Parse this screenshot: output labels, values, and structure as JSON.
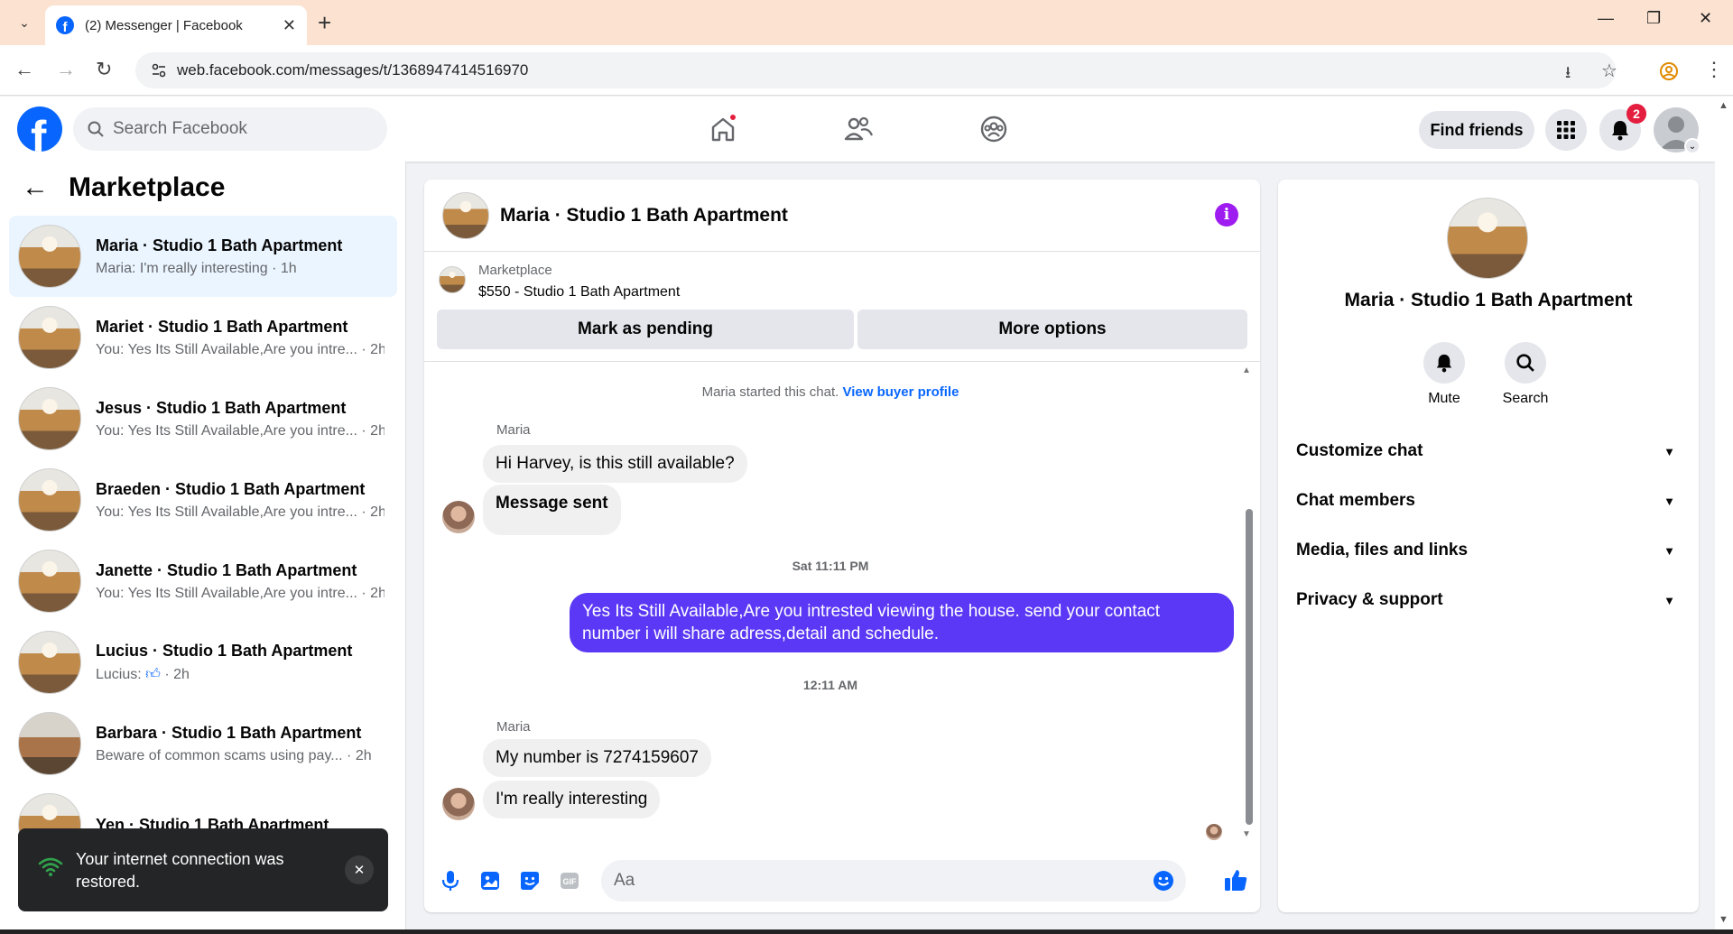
{
  "browser": {
    "tab_title": "(2) Messenger | Facebook",
    "url": "web.facebook.com/messages/t/1368947414516970"
  },
  "fb": {
    "search_placeholder": "Search Facebook",
    "find_friends": "Find friends",
    "notification_count": "2"
  },
  "sidebar": {
    "title": "Marketplace",
    "conversations": [
      {
        "name": "Maria · Studio 1 Bath Apartment",
        "preview": "Maria: I'm really interesting · 1h"
      },
      {
        "name": "Mariet · Studio 1 Bath Apartment",
        "preview": "You: Yes Its Still Available,Are you intre... · 2h"
      },
      {
        "name": "Jesus · Studio 1 Bath Apartment",
        "preview": "You: Yes Its Still Available,Are you intre... · 2h"
      },
      {
        "name": "Braeden · Studio 1 Bath Apartment",
        "preview": "You: Yes Its Still Available,Are you intre... · 2h"
      },
      {
        "name": "Janette · Studio 1 Bath Apartment",
        "preview": "You: Yes Its Still Available,Are you intre... · 2h"
      },
      {
        "name": "Lucius · Studio 1 Bath Apartment",
        "preview_prefix": "Lucius:",
        "preview_suffix": "· 2h"
      },
      {
        "name": "Barbara · Studio 1 Bath Apartment",
        "preview": "Beware of common scams using pay...  · 2h"
      },
      {
        "name": "Yen · Studio 1 Bath Apartment"
      }
    ]
  },
  "toast": {
    "text": "Your internet connection was restored."
  },
  "chat": {
    "title": "Maria · Studio 1 Bath Apartment",
    "listing_label": "Marketplace",
    "listing_price": "$550 - Studio 1 Bath Apartment",
    "mark_pending": "Mark as pending",
    "more_options": "More options",
    "system_text": "Maria started this chat.",
    "system_link": "View buyer profile",
    "sender1": "Maria",
    "msg1": "Hi Harvey, is this still available?",
    "msg2": "Message sent",
    "time1": "Sat 11:11 PM",
    "msg_out": "Yes Its Still Available,Are you intrested viewing the house. send your contact number i will share adress,detail and schedule.",
    "time2": "12:11 AM",
    "sender2": "Maria",
    "msg3": "My number is 7274159607",
    "msg4": "I'm really interesting",
    "composer_placeholder": "Aa"
  },
  "panel": {
    "name": "Maria · Studio 1 Bath Apartment",
    "mute": "Mute",
    "search": "Search",
    "sections": [
      "Customize chat",
      "Chat members",
      "Media, files and links",
      "Privacy & support"
    ]
  },
  "colors": {
    "brand": "#0866ff",
    "outgoing_bubble": "#5b38f5",
    "info_icon": "#9f1cf1",
    "badge": "#e41e3f"
  }
}
